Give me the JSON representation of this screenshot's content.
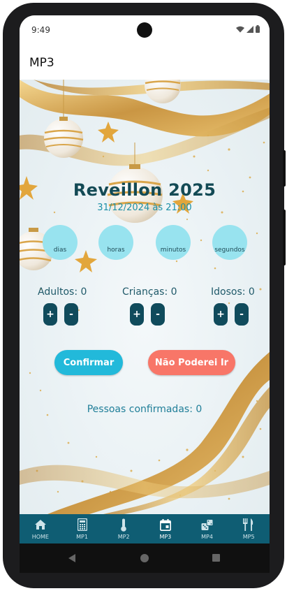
{
  "status_bar": {
    "time": "9:49"
  },
  "app_bar": {
    "title": "MP3"
  },
  "event": {
    "title": "Reveillon 2025",
    "datetime": "31/12/2024 às 21:00"
  },
  "countdown": [
    {
      "label": "dias"
    },
    {
      "label": "horas"
    },
    {
      "label": "minutos"
    },
    {
      "label": "segundos"
    }
  ],
  "guests": {
    "adults": {
      "label": "Adultos: 0",
      "plus": "+",
      "minus": "-"
    },
    "children": {
      "label": "Crianças: 0",
      "plus": "+",
      "minus": "-"
    },
    "elderly": {
      "label": "Idosos: 0",
      "plus": "+",
      "minus": "-"
    }
  },
  "actions": {
    "confirm": "Confirmar",
    "decline": "Não Poderei Ir"
  },
  "summary": {
    "confirmed": "Pessoas confirmadas: 0"
  },
  "bottom_nav": [
    {
      "label": "HOME",
      "icon": "home-icon"
    },
    {
      "label": "MP1",
      "icon": "calculator-icon"
    },
    {
      "label": "MP2",
      "icon": "thermometer-icon"
    },
    {
      "label": "MP3",
      "icon": "calendar-icon"
    },
    {
      "label": "MP4",
      "icon": "dice-icon"
    },
    {
      "label": "MP5",
      "icon": "cutlery-icon"
    }
  ],
  "colors": {
    "title": "#134a55",
    "accent": "#1b8fa6",
    "circle": "#98e3ef",
    "stepper": "#104b5c",
    "confirm": "#22b9da",
    "decline": "#f87668",
    "nav": "#0f5d73"
  }
}
